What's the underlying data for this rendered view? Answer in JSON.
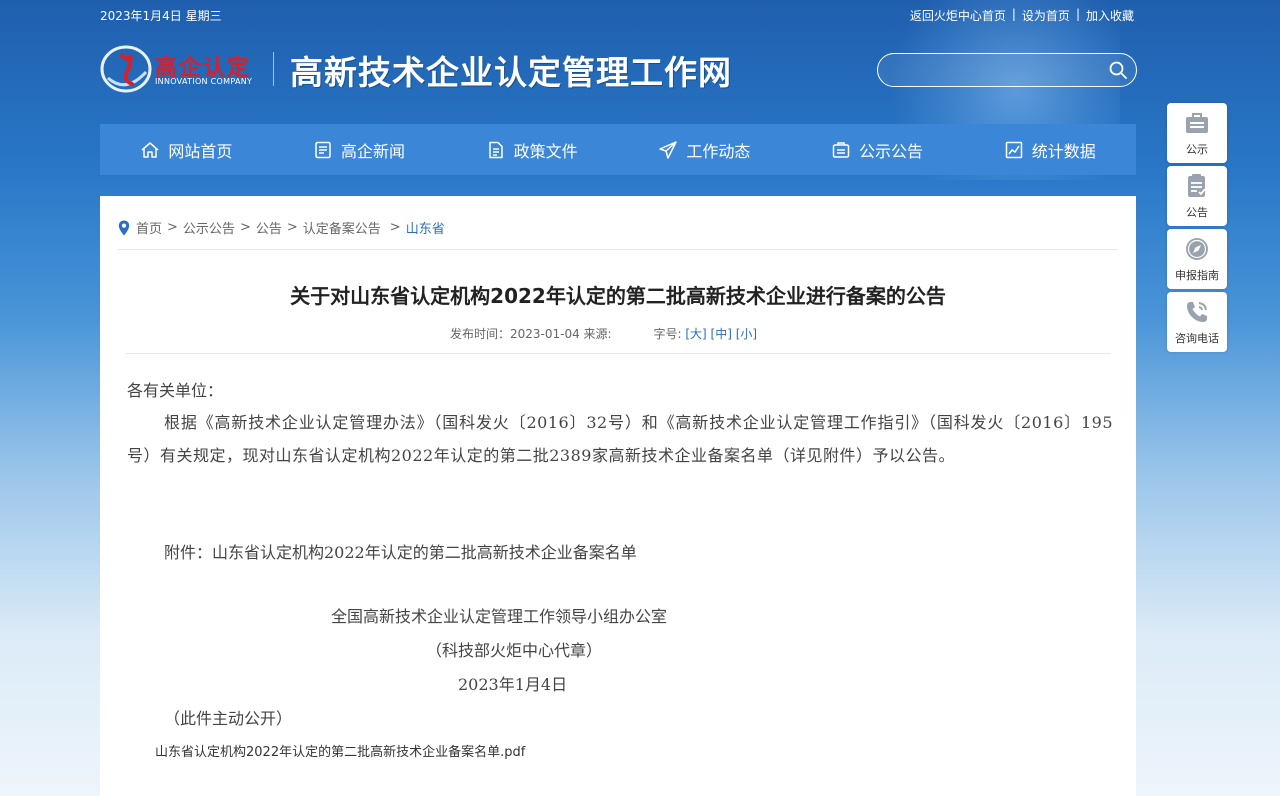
{
  "topbar": {
    "date": "2023年1月4日 星期三",
    "links": [
      "返回火炬中心首页",
      "设为首页",
      "加入收藏"
    ],
    "separator": "|"
  },
  "logo": {
    "text": "高企认定",
    "sub": "INNOVATION COMPANY"
  },
  "site_title": "高新技术企业认定管理工作网",
  "search": {
    "placeholder": ""
  },
  "nav": [
    {
      "label": "网站首页",
      "icon": "home-icon"
    },
    {
      "label": "高企新闻",
      "icon": "news-icon"
    },
    {
      "label": "政策文件",
      "icon": "document-icon"
    },
    {
      "label": "工作动态",
      "icon": "paper-plane-icon"
    },
    {
      "label": "公示公告",
      "icon": "announcement-icon"
    },
    {
      "label": "统计数据",
      "icon": "chart-icon"
    }
  ],
  "breadcrumb": {
    "items": [
      "首页",
      "公示公告",
      "公告",
      "认定备案公告",
      "山东省"
    ],
    "sep": ">"
  },
  "article": {
    "title": "关于对山东省认定机构2022年认定的第二批高新技术企业进行备案的公告",
    "publish_label": "发布时间：2023-01-04 来源:",
    "font_label": "字号:",
    "sizes": [
      "[大]",
      "[中]",
      "[小]"
    ],
    "salutation": "各有关单位：",
    "main": "根据《高新技术企业认定管理办法》（国科发火〔2016〕32号）和《高新技术企业认定管理工作指引》（国科发火〔2016〕195号）有关规定，现对山东省认定机构2022年认定的第二批2389家高新技术企业备案名单（详见附件）予以公告。",
    "attachment": "附件：山东省认定机构2022年认定的第二批高新技术企业备案名单",
    "signature1": "全国高新技术企业认定管理工作领导小组办公室",
    "signature2": "（科技部火炬中心代章）",
    "date": "2023年1月4日",
    "public_note": "（此件主动公开）",
    "pdf": "山东省认定机构2022年认定的第二批高新技术企业备案名单.pdf"
  },
  "side": [
    {
      "label": "公示",
      "icon": "briefcase-icon"
    },
    {
      "label": "公告",
      "icon": "clipboard-icon"
    },
    {
      "label": "申报指南",
      "icon": "compass-icon"
    },
    {
      "label": "咨询电话",
      "icon": "phone-icon"
    }
  ],
  "colors": {
    "nav_bg": "#3b86d6",
    "link_blue": "#2b6fc0",
    "logo_red": "#d8202a"
  }
}
